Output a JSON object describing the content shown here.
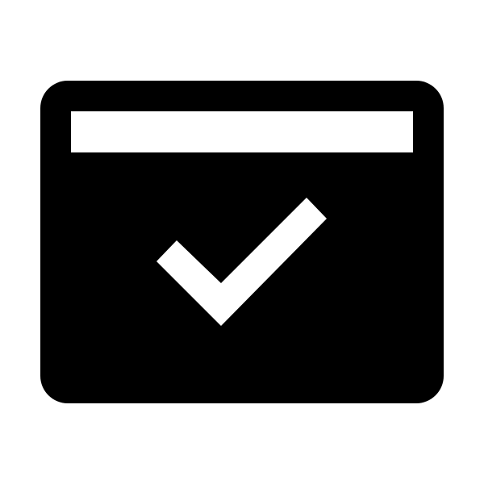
{
  "icon": {
    "name": "browser-window-check-icon",
    "parts": [
      "window-frame",
      "title-bar",
      "checkmark"
    ],
    "colors": {
      "background": "#ffffff",
      "frame": "#000000",
      "cutout": "#ffffff"
    }
  }
}
